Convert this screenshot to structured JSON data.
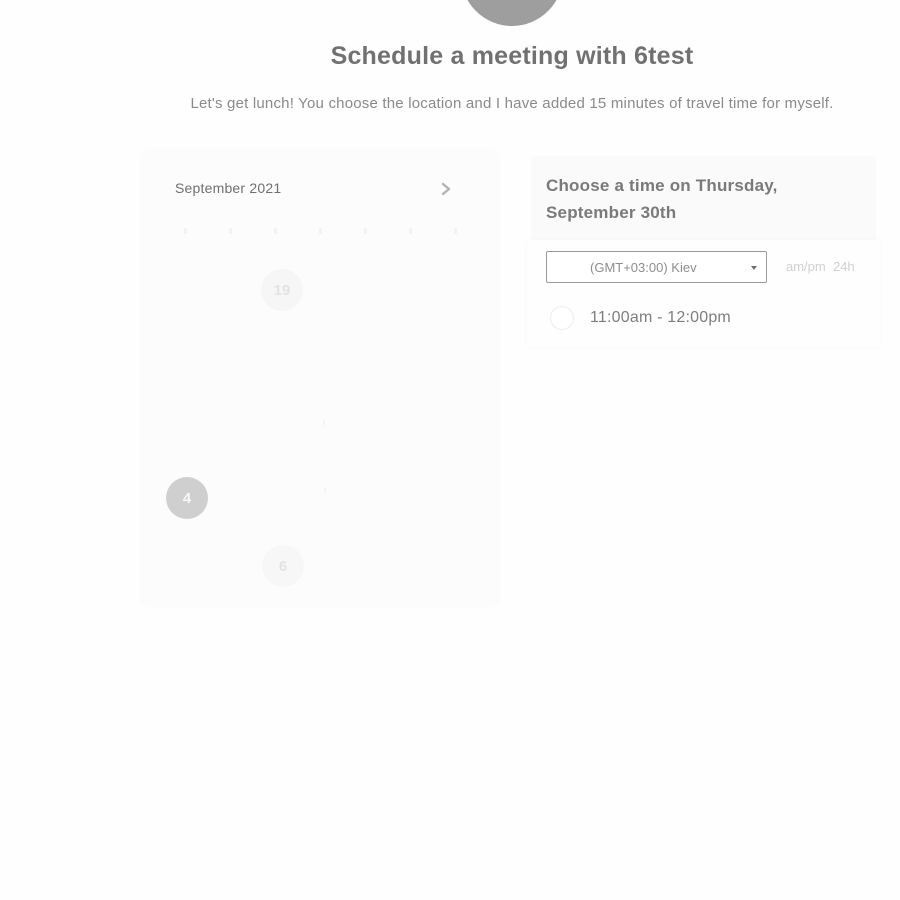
{
  "header": {
    "title": "Schedule a meeting with 6test",
    "description": "Let's get lunch! You choose the location and I have added 15 minutes of travel time for myself."
  },
  "calendar": {
    "month_label": "September 2021",
    "next_icon": "chevron-right-icon",
    "visible_days": [
      "19",
      "4",
      "6"
    ],
    "selected_day": "4"
  },
  "time_panel": {
    "title": "Choose a time on Thursday, September 30th",
    "timezone": {
      "selected": "(GMT+03:00) Kiev",
      "icon": "caret-down-icon"
    },
    "format_toggle": {
      "ampm": "am/pm",
      "h24": "24h"
    },
    "slots": [
      {
        "label": "11:00am - 12:00pm"
      }
    ]
  },
  "colors": {
    "avatar": "#9e9e9e",
    "title_text": "#717171",
    "selected_day_bg": "#cfcfcf",
    "select_border": "#9a9a9a"
  }
}
